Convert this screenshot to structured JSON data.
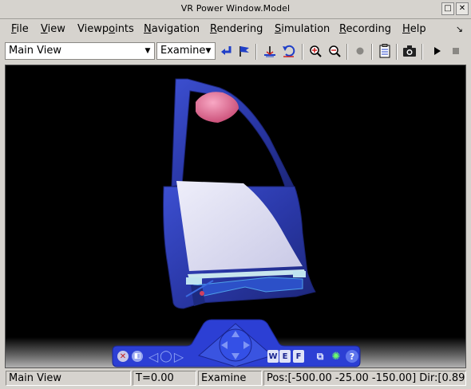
{
  "window": {
    "title": "VR Power Window.Model",
    "btn_max": "□",
    "btn_close": "✕"
  },
  "menu": {
    "items": [
      {
        "pre": "",
        "u": "F",
        "post": "ile"
      },
      {
        "pre": "",
        "u": "V",
        "post": "iew"
      },
      {
        "pre": "Viewp",
        "u": "o",
        "post": "ints"
      },
      {
        "pre": "",
        "u": "N",
        "post": "avigation"
      },
      {
        "pre": "",
        "u": "R",
        "post": "endering"
      },
      {
        "pre": "",
        "u": "S",
        "post": "imulation"
      },
      {
        "pre": "",
        "u": "R",
        "post": "ecording"
      },
      {
        "pre": "",
        "u": "H",
        "post": "elp"
      }
    ],
    "more": "↘"
  },
  "toolbar": {
    "viewpoint_select": "Main View",
    "navmode_select": "Examine",
    "icons": [
      "return-to-viewpoint-icon",
      "create-viewpoint-icon",
      "straighten-up-icon",
      "undo-move-icon",
      "zoom-in-icon",
      "zoom-out-icon",
      "record-icon",
      "parameters-icon",
      "snapshot-icon",
      "play-icon",
      "stop-icon"
    ]
  },
  "navpanel": {
    "wire_label": "W",
    "edge_label": "E",
    "face_label": "F",
    "help_label": "?"
  },
  "status": {
    "viewpoint": "Main View",
    "time": "T=0.00",
    "navmode": "Examine",
    "position": "Pos:[-500.00 -25.00 -150.00] Dir:[0.89"
  },
  "colors": {
    "door_blue": "#2f3fb8",
    "glass": "#dcdcf0",
    "pink_shape": "#e06a90",
    "nav_blue": "#2c3fd4"
  }
}
